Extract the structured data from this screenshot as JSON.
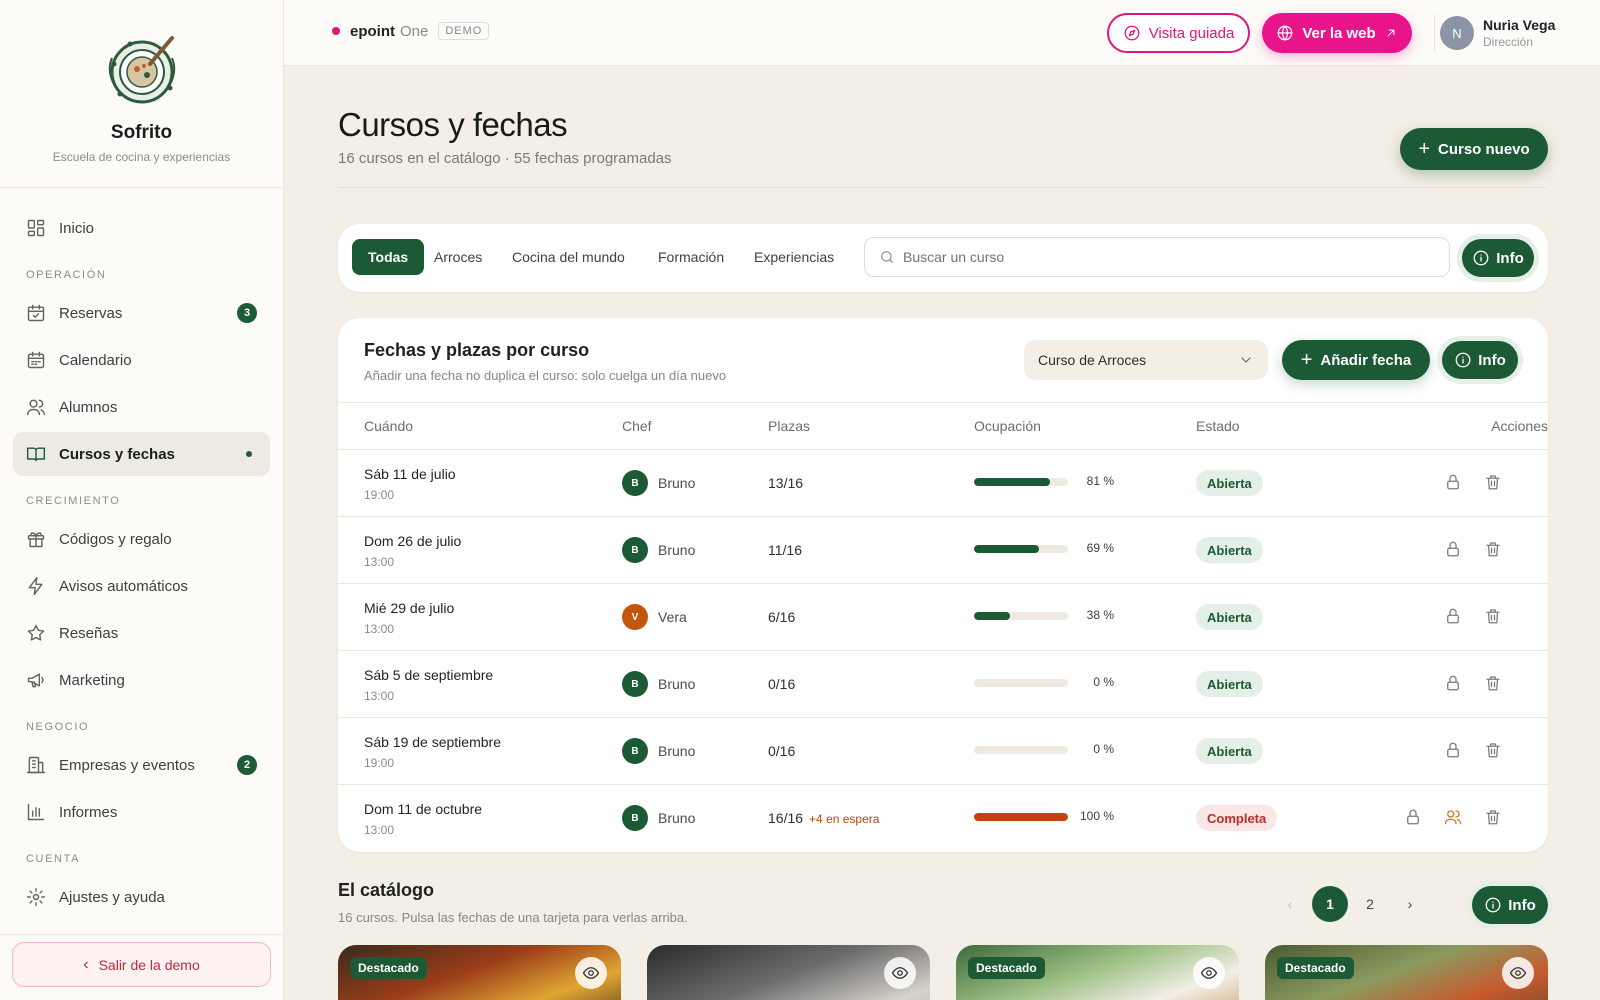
{
  "brand": {
    "name": "Sofrito",
    "tagline": "Escuela de cocina y experiencias"
  },
  "sidebar": {
    "home": {
      "label": "Inicio",
      "icon": "dashboard-icon"
    },
    "sections": [
      {
        "title": "OPERACIÓN"
      },
      {
        "title": "CRECIMIENTO"
      },
      {
        "title": "NEGOCIO"
      },
      {
        "title": "CUENTA"
      }
    ],
    "items": [
      {
        "label": "Reservas",
        "icon": "calendar-check-icon",
        "badge": "3"
      },
      {
        "label": "Calendario",
        "icon": "calendar-icon"
      },
      {
        "label": "Alumnos",
        "icon": "users-icon"
      },
      {
        "label": "Cursos y fechas",
        "icon": "book-open-icon",
        "active": true
      },
      {
        "label": "Códigos y regalo",
        "icon": "gift-icon"
      },
      {
        "label": "Avisos automáticos",
        "icon": "bolt-icon"
      },
      {
        "label": "Reseñas",
        "icon": "star-icon"
      },
      {
        "label": "Marketing",
        "icon": "megaphone-icon"
      },
      {
        "label": "Empresas y eventos",
        "icon": "building-icon",
        "badge": "2"
      },
      {
        "label": "Informes",
        "icon": "bar-chart-icon"
      },
      {
        "label": "Ajustes y ayuda",
        "icon": "gear-icon"
      }
    ],
    "exit_label": "Salir de la demo"
  },
  "topbar": {
    "product_name": "epoint",
    "product_suffix": "One",
    "demo_tag": "DEMO",
    "guided_label": "Visita guiada",
    "web_label": "Ver la web",
    "user": {
      "initial": "N",
      "name": "Nuria Vega",
      "role": "Dirección"
    }
  },
  "page": {
    "title": "Cursos y fechas",
    "subtitle": "16 cursos en el catálogo · 55 fechas programadas",
    "new_course_label": "Curso nuevo"
  },
  "filters": {
    "chips": [
      "Todas",
      "Arroces",
      "Cocina del mundo",
      "Formación",
      "Experiencias"
    ],
    "active": "Todas",
    "search_placeholder": "Buscar un curso",
    "info_label": "Info"
  },
  "schedule": {
    "title": "Fechas y plazas por curso",
    "subtitle": "Añadir una fecha no duplica el curso: solo cuelga un día nuevo",
    "selected_course": "Curso de Arroces",
    "add_label": "Añadir fecha",
    "info_label": "Info",
    "columns": [
      "Cuándo",
      "Chef",
      "Plazas",
      "Ocupación",
      "Estado",
      "Acciones"
    ],
    "rows": [
      {
        "date": "Sáb 11 de julio",
        "time": "19:00",
        "chef_initial": "B",
        "chef": "Bruno",
        "chef_color": "#1c5a35",
        "seats": "13/16",
        "waitlist": "",
        "occupancy": 81,
        "occupancy_label": "81 %",
        "status": "Abierta",
        "status_kind": "open"
      },
      {
        "date": "Dom 26 de julio",
        "time": "13:00",
        "chef_initial": "B",
        "chef": "Bruno",
        "chef_color": "#1c5a35",
        "seats": "11/16",
        "waitlist": "",
        "occupancy": 69,
        "occupancy_label": "69 %",
        "status": "Abierta",
        "status_kind": "open"
      },
      {
        "date": "Mié 29 de julio",
        "time": "13:00",
        "chef_initial": "V",
        "chef": "Vera",
        "chef_color": "#c2560f",
        "seats": "6/16",
        "waitlist": "",
        "occupancy": 38,
        "occupancy_label": "38 %",
        "status": "Abierta",
        "status_kind": "open"
      },
      {
        "date": "Sáb 5 de septiembre",
        "time": "13:00",
        "chef_initial": "B",
        "chef": "Bruno",
        "chef_color": "#1c5a35",
        "seats": "0/16",
        "waitlist": "",
        "occupancy": 0,
        "occupancy_label": "0 %",
        "status": "Abierta",
        "status_kind": "open"
      },
      {
        "date": "Sáb 19 de septiembre",
        "time": "19:00",
        "chef_initial": "B",
        "chef": "Bruno",
        "chef_color": "#1c5a35",
        "seats": "0/16",
        "waitlist": "",
        "occupancy": 0,
        "occupancy_label": "0 %",
        "status": "Abierta",
        "status_kind": "open"
      },
      {
        "date": "Dom 11 de octubre",
        "time": "13:00",
        "chef_initial": "B",
        "chef": "Bruno",
        "chef_color": "#1c5a35",
        "seats": "16/16",
        "waitlist": "+4 en espera",
        "occupancy": 100,
        "occupancy_label": "100 %",
        "status": "Completa",
        "status_kind": "full"
      }
    ]
  },
  "catalog": {
    "title": "El catálogo",
    "subtitle": "16 cursos. Pulsa las fechas de una tarjeta para verlas arriba.",
    "pages": [
      "1",
      "2"
    ],
    "current_page": "1",
    "info_label": "Info",
    "tiles": [
      {
        "tag": "Destacado"
      },
      {
        "tag": ""
      },
      {
        "tag": "Destacado"
      },
      {
        "tag": "Destacado"
      }
    ]
  },
  "colors": {
    "primary": "#1c5a35",
    "accent": "#e9148a",
    "danger": "#c2292a",
    "bar_full": "#c2410c"
  }
}
